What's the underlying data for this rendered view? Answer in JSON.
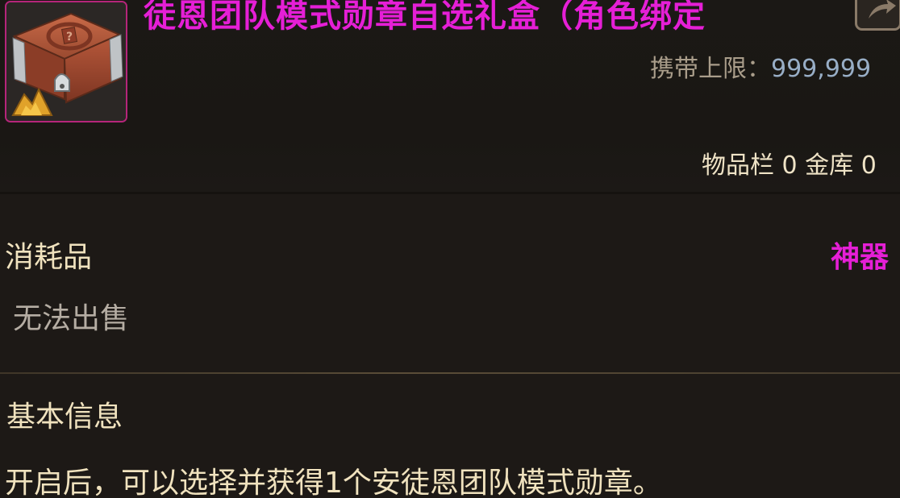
{
  "item": {
    "name": "徒恩团队模式勋章自选礼盒（角色绑定",
    "icon": "treasure-chest-icon",
    "frame_color": "#b5257a",
    "name_color": "#e51fd6"
  },
  "limit": {
    "label": "携带上限：",
    "value": "999,999"
  },
  "storage": {
    "text": "物品栏 0 金库 0"
  },
  "details": {
    "category": "消耗品",
    "rarity": "神器",
    "sale_status": "无法出售"
  },
  "basic_info": {
    "title": "基本信息",
    "description": "开启后，可以选择并获得1个安徒恩团队模式勋章。"
  }
}
